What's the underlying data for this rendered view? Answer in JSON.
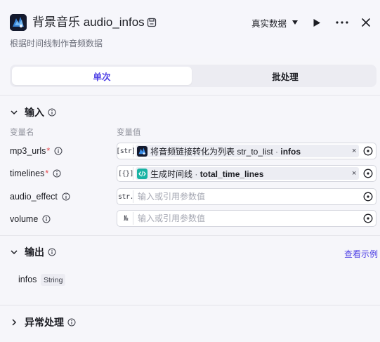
{
  "header": {
    "title": "背景音乐 audio_infos",
    "subtitle": "根据时间线制作音频数据",
    "data_select": "真实数据"
  },
  "tabs": [
    {
      "label": "单次",
      "active": true
    },
    {
      "label": "批处理",
      "active": false
    }
  ],
  "input_section": {
    "title": "输入",
    "col_name": "变量名",
    "col_value": "变量值",
    "params": [
      {
        "name": "mp3_urls",
        "required": true,
        "type": "[str]",
        "ref_node": "将音频链接转化为列表 str_to_list",
        "ref_sep": " · ",
        "ref_field": "infos"
      },
      {
        "name": "timelines",
        "required": true,
        "type": "[{}]",
        "ref_node": "生成时间线",
        "ref_sep": " · ",
        "ref_field": "total_time_lines"
      },
      {
        "name": "audio_effect",
        "required": false,
        "type": "str.",
        "placeholder": "输入或引用参数值"
      },
      {
        "name": "volume",
        "required": false,
        "type": "№",
        "placeholder": "输入或引用参数值"
      }
    ],
    "clear_symbol": "×"
  },
  "output_section": {
    "title": "输出",
    "example_link": "查看示例",
    "outputs": [
      {
        "name": "infos",
        "type": "String"
      }
    ]
  },
  "error_section": {
    "title": "异常处理"
  },
  "icons": [
    "app-icon",
    "save-icon",
    "caret-down-icon",
    "play-icon",
    "more-icon",
    "close-icon",
    "chevron-down-icon",
    "chevron-right-icon",
    "info-icon",
    "target-icon",
    "code-icon"
  ],
  "colors": {
    "accent": "#4e40e5",
    "required": "#e5484d",
    "code_chip": "#18b3a4",
    "app_icon_bg": "#141a2e"
  }
}
